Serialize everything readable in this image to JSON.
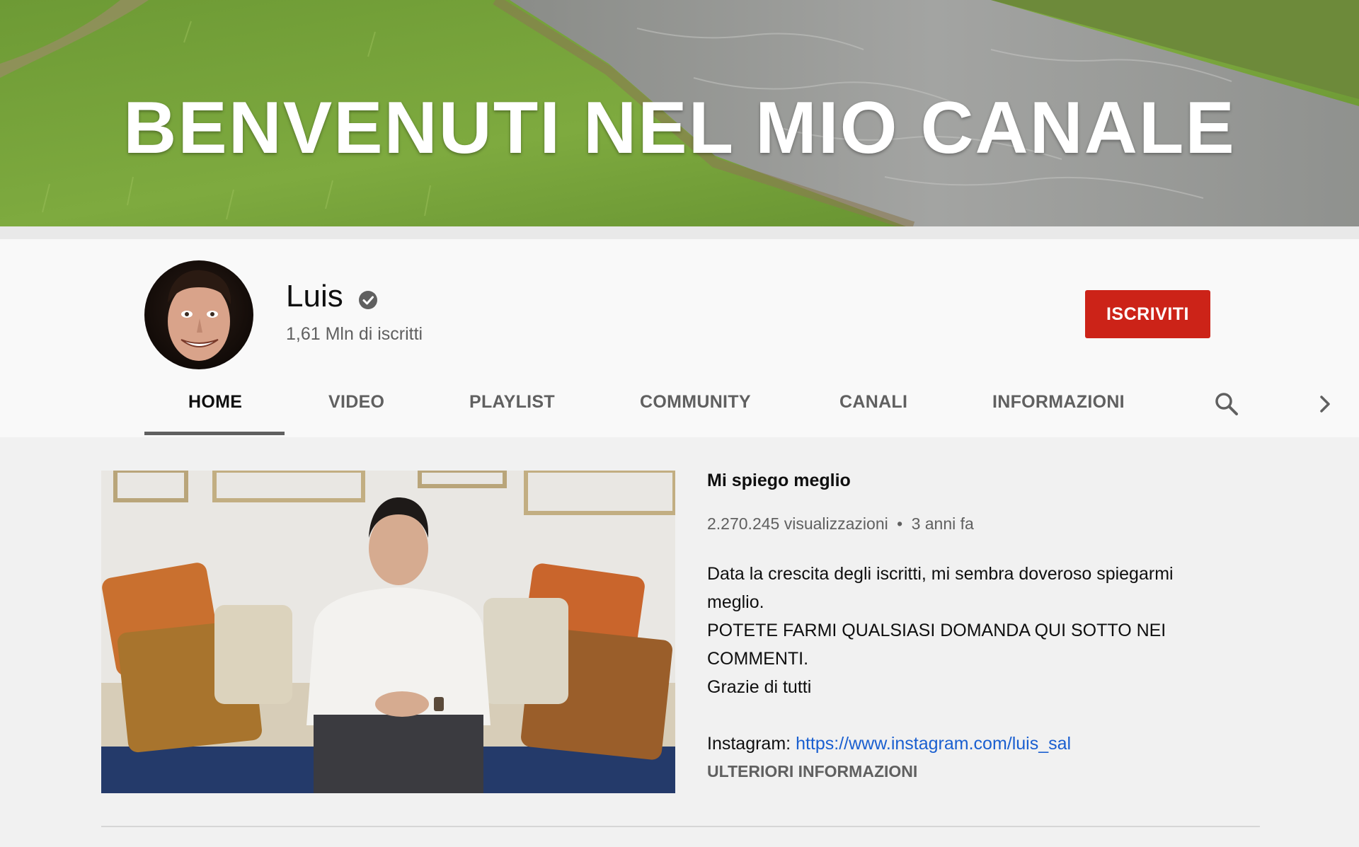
{
  "banner": {
    "title": "BENVENUTI NEL MIO CANALE"
  },
  "channel": {
    "name": "Luis",
    "subscribers": "1,61 Mln di iscritti",
    "subscribe_label": "ISCRIVITI",
    "verified_icon": "verified-check-icon",
    "subscribe_color": "#cc2318"
  },
  "tabs": [
    {
      "label": "HOME",
      "active": true
    },
    {
      "label": "VIDEO",
      "active": false
    },
    {
      "label": "PLAYLIST",
      "active": false
    },
    {
      "label": "COMMUNITY",
      "active": false
    },
    {
      "label": "CANALI",
      "active": false
    },
    {
      "label": "INFORMAZIONI",
      "active": false
    }
  ],
  "tab_icons": {
    "search": "search-icon",
    "next": "chevron-right-icon"
  },
  "featured": {
    "title": "Mi spiego meglio",
    "views": "2.270.245 visualizzazioni",
    "separator": "•",
    "age": "3 anni fa",
    "description": [
      "Data la crescita degli iscritti, mi sembra doveroso spiegarmi",
      "meglio.",
      "POTETE FARMI QUALSIASI DOMANDA QUI SOTTO NEI",
      "COMMENTI.",
      "Grazie di tutti"
    ],
    "instagram_label": "Instagram:",
    "instagram_url": "https://www.instagram.com/luis_sal",
    "more_label": "ULTERIORI INFORMAZIONI",
    "link_color": "#1a5fd0"
  }
}
